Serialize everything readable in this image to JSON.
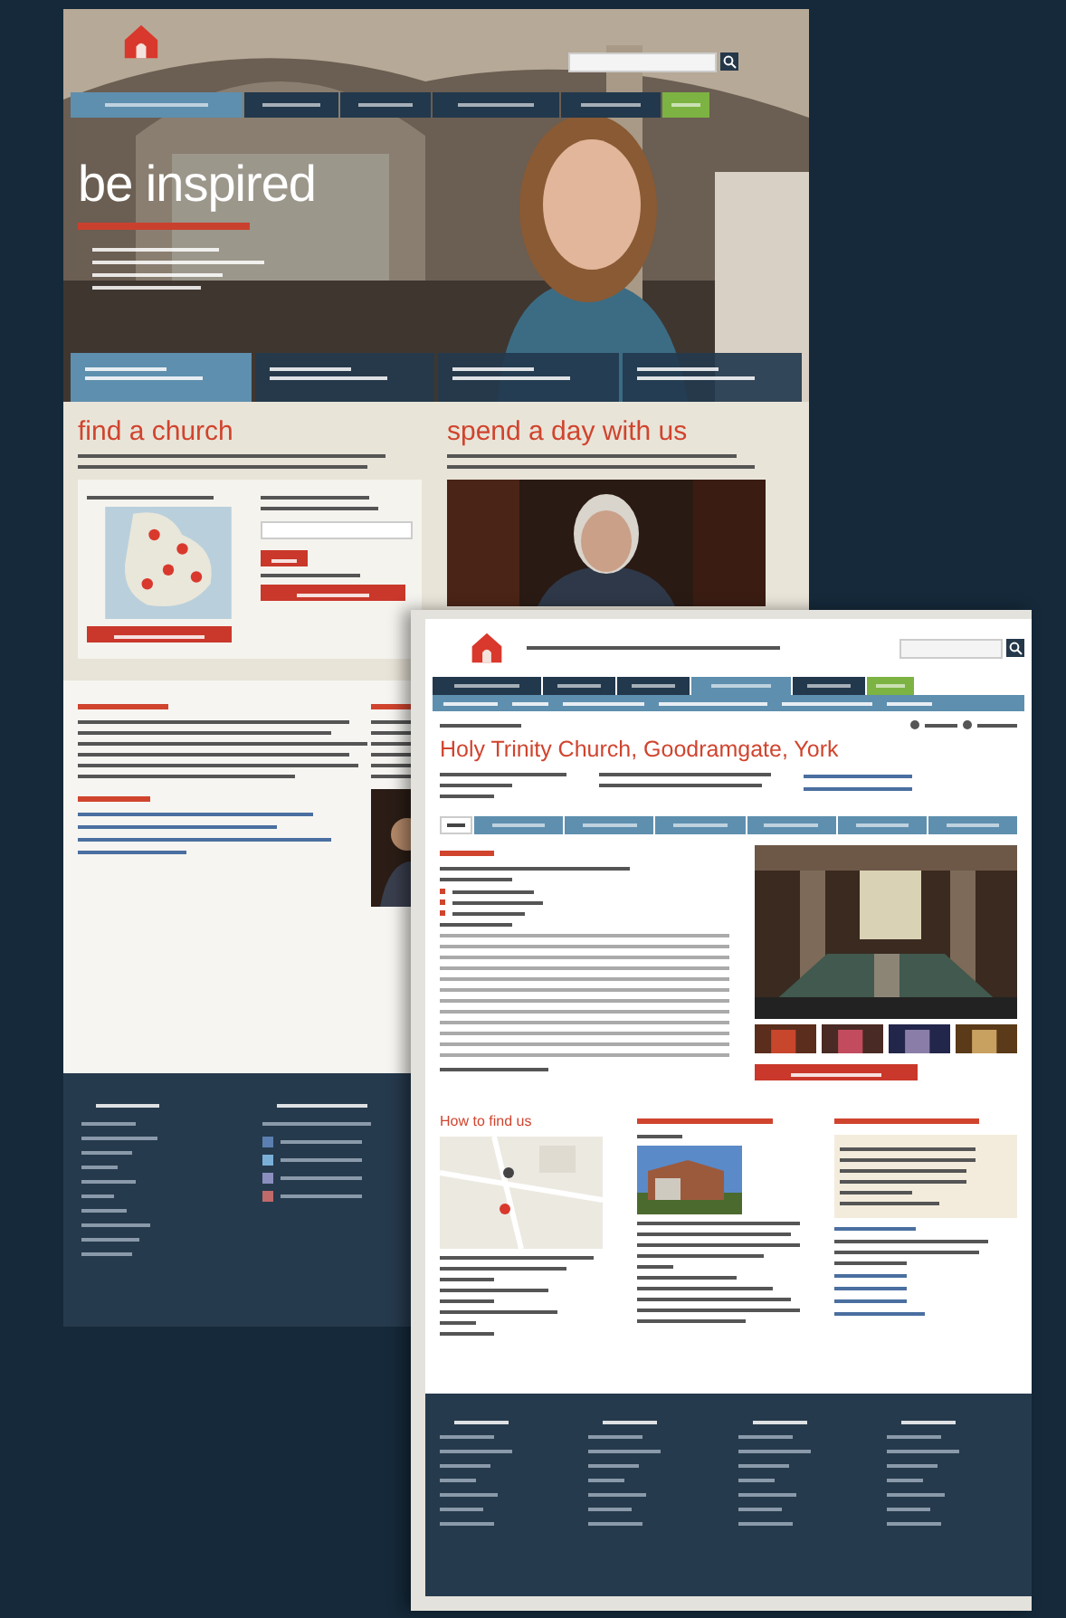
{
  "home_page": {
    "nav": [
      {
        "kind": "link",
        "selected": true
      },
      {
        "kind": "link",
        "selected": false
      },
      {
        "kind": "link",
        "selected": false
      },
      {
        "kind": "link",
        "selected": false
      },
      {
        "kind": "link",
        "selected": false
      },
      {
        "kind": "donate",
        "selected": false
      }
    ],
    "hero_heading": "be inspired",
    "hero_tabs": [
      {
        "selected": true
      },
      {
        "selected": false
      },
      {
        "selected": false
      },
      {
        "selected": false
      }
    ],
    "find_heading": "find a church",
    "visit_heading": "spend a day with us"
  },
  "church_page": {
    "nav": [
      {
        "kind": "link",
        "selected": false
      },
      {
        "kind": "link",
        "selected": false
      },
      {
        "kind": "link",
        "selected": false
      },
      {
        "kind": "link",
        "selected": true
      },
      {
        "kind": "link",
        "selected": false
      },
      {
        "kind": "donate",
        "selected": false
      }
    ],
    "title": "Holy Trinity Church, Goodramgate, York",
    "tabs": [
      {
        "selected": true
      },
      {
        "selected": false
      },
      {
        "selected": false
      },
      {
        "selected": false
      },
      {
        "selected": false
      },
      {
        "selected": false
      },
      {
        "selected": false
      }
    ],
    "directions_heading": "How to find us"
  }
}
